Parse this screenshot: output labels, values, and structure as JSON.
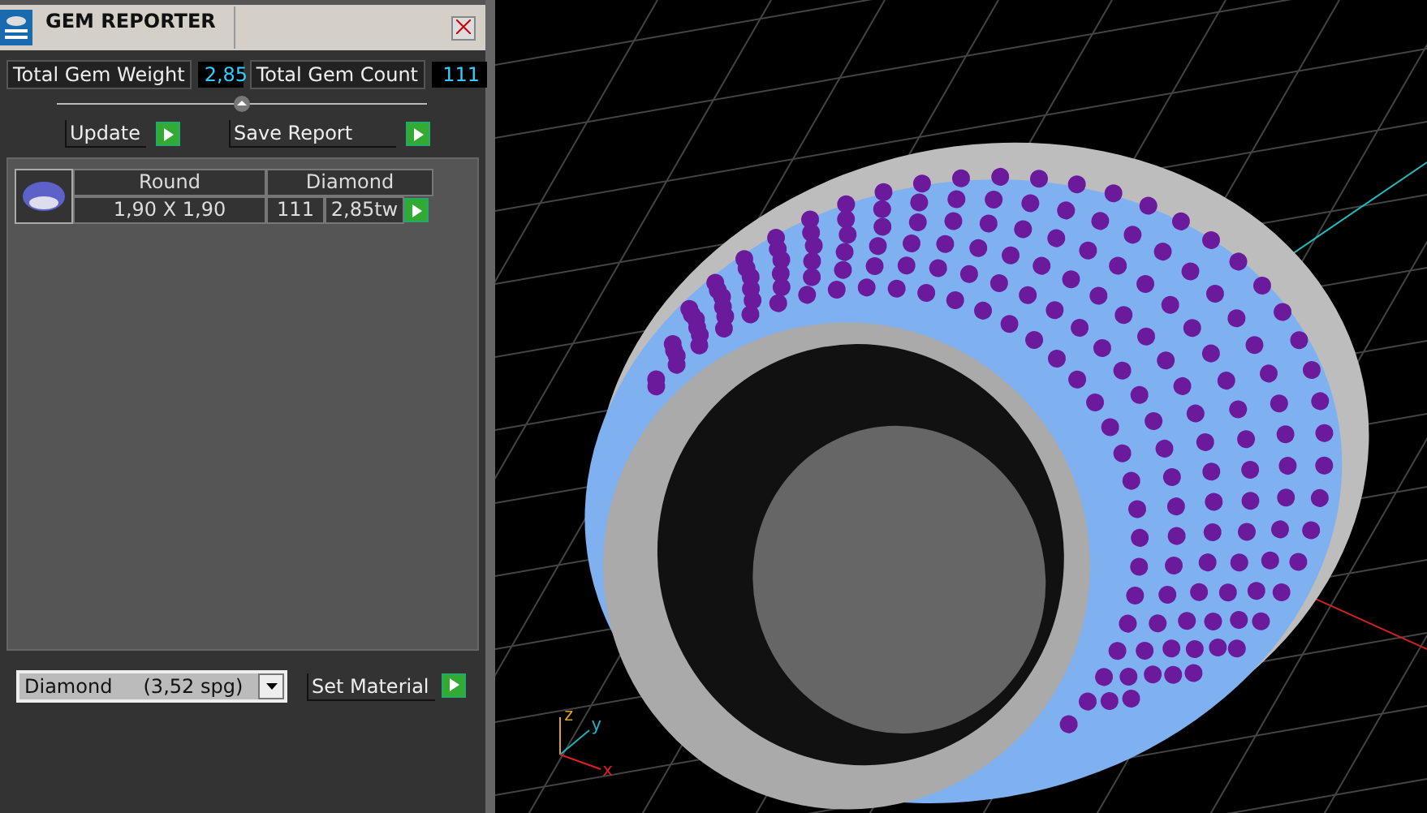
{
  "panel": {
    "title": "GEM REPORTER",
    "totals": [
      {
        "label": "Total Gem Weight",
        "value": "2,85"
      },
      {
        "label": "Total Gem Count",
        "value": "111"
      }
    ],
    "actions": [
      "Update",
      "Save Report"
    ],
    "gems": [
      {
        "shape": "Round",
        "size": "1,90 X 1,90",
        "material": "Diamond",
        "count": "111",
        "weight": "2,85tw"
      }
    ],
    "material_select": {
      "value": "Diamond     (3,52 spg)"
    },
    "set_button": "Set Material"
  },
  "viewport": {
    "axes": [
      {
        "label": "z",
        "color": "#e0a020"
      },
      {
        "label": "y",
        "color": "#20b0c0"
      },
      {
        "label": "x",
        "color": "#e02020"
      }
    ]
  }
}
